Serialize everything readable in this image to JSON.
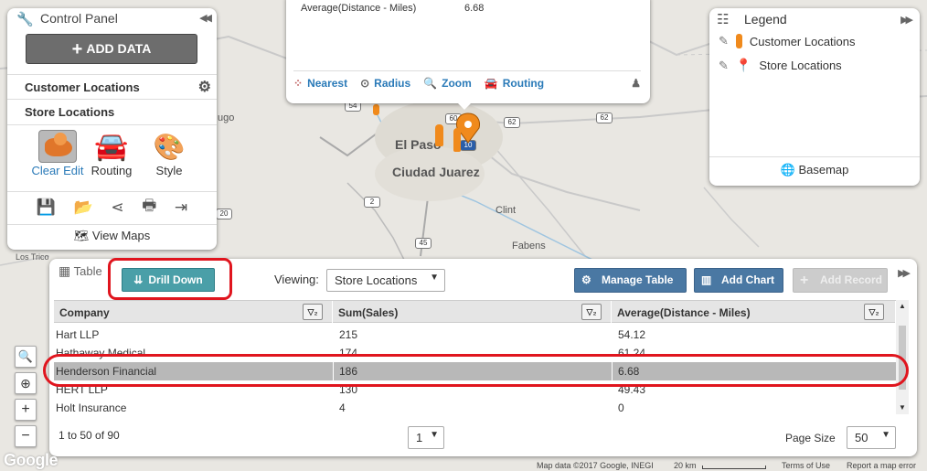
{
  "map": {
    "labels": {
      "el_paso": "El Paso",
      "ciudad_juarez": "Ciudad Juarez",
      "clint": "Clint",
      "fabens": "Fabens",
      "los_tricos": "Los Trico",
      "rugo": "ugo"
    },
    "shields": [
      "54",
      "60",
      "62",
      "62",
      "10",
      "2",
      "45",
      "20"
    ],
    "google_logo": "Google",
    "attribution": {
      "data": "Map data ©2017 Google, INEGI",
      "scale": "20 km",
      "terms": "Terms of Use",
      "report": "Report a map error"
    },
    "zoom_in": "+",
    "zoom_out": "−"
  },
  "control_panel": {
    "title": "Control Panel",
    "add_data_label": "ADD DATA",
    "layers": [
      "Customer Locations",
      "Store Locations"
    ],
    "tools": {
      "clear_label": "Clear",
      "edit_label": "Edit",
      "routing_label": "Routing",
      "style_label": "Style"
    },
    "view_maps_label": "View Maps"
  },
  "popup": {
    "field_label": "Average(Distance - Miles)",
    "field_value": "6.68",
    "actions": [
      "Nearest",
      "Radius",
      "Zoom",
      "Routing"
    ]
  },
  "legend": {
    "title": "Legend",
    "items": [
      "Customer Locations",
      "Store Locations"
    ],
    "basemap_label": "Basemap"
  },
  "table_panel": {
    "title": "Table",
    "drill_down_label": "Drill Down",
    "viewing_label": "Viewing:",
    "viewing_value": "Store Locations",
    "manage_table_label": "Manage Table",
    "add_chart_label": "Add Chart",
    "add_record_label": "Add Record",
    "columns": [
      "Company",
      "Sum(Sales)",
      "Average(Distance - Miles)"
    ],
    "rows": [
      {
        "company": "Hart LLP",
        "sales": "215",
        "distance": "54.12"
      },
      {
        "company": "Hathaway Medical",
        "sales": "174",
        "distance": "61.24"
      },
      {
        "company": "Henderson Financial",
        "sales": "186",
        "distance": "6.68"
      },
      {
        "company": "HERT LLP",
        "sales": "130",
        "distance": "49.43"
      },
      {
        "company": "Holt Insurance",
        "sales": "4",
        "distance": "0"
      }
    ],
    "pager_text": "1 to 50 of 90",
    "page_value": "1",
    "page_size_label": "Page Size",
    "page_size_value": "50"
  },
  "colors": {
    "highlight": "#e0151e",
    "accent_blue": "#2a7ab8",
    "drill_teal": "#4a9fa8",
    "button_blue": "#4a78a3",
    "customer_marker": "#f08a1c",
    "store_marker": "#2a7ab8"
  }
}
